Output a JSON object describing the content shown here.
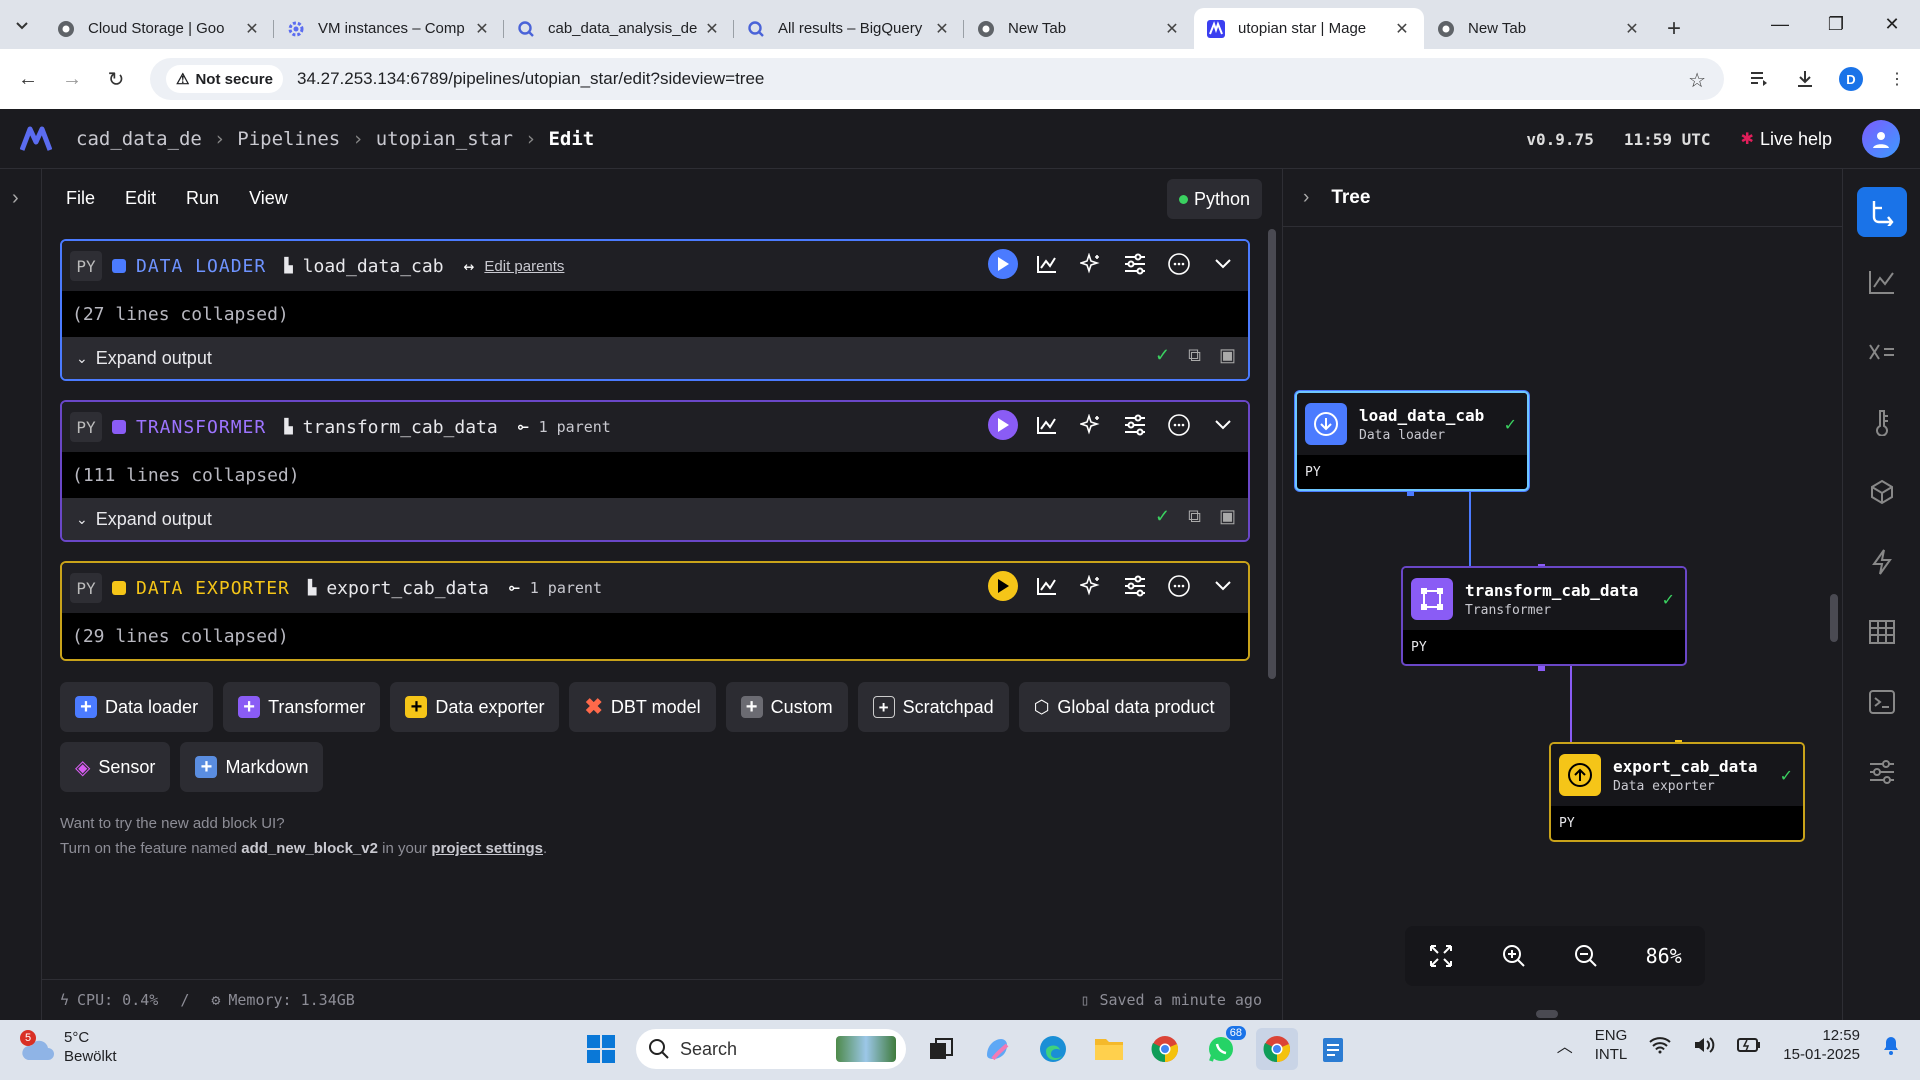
{
  "browser": {
    "tabs": [
      {
        "title": "Cloud Storage | Goo",
        "icon": "chrome-icon"
      },
      {
        "title": "VM instances – Comp",
        "icon": "gear-icon"
      },
      {
        "title": "cab_data_analysis_de",
        "icon": "bigquery-icon"
      },
      {
        "title": "All results – BigQuery",
        "icon": "bigquery-icon"
      },
      {
        "title": "New Tab",
        "icon": "chrome-icon"
      },
      {
        "title": "utopian star | Mage",
        "icon": "mage-icon",
        "active": true
      },
      {
        "title": "New Tab",
        "icon": "chrome-icon"
      }
    ],
    "security_label": "Not secure",
    "url": "34.27.253.134:6789/pipelines/utopian_star/edit?sideview=tree",
    "profile_initial": "D"
  },
  "app": {
    "breadcrumbs": [
      "cad_data_de",
      "Pipelines",
      "utopian_star",
      "Edit"
    ],
    "version": "v0.9.75",
    "time": "11:59 UTC",
    "live_help": "Live help",
    "menu": [
      "File",
      "Edit",
      "Run",
      "View"
    ],
    "language": "Python",
    "blocks": [
      {
        "py": "PY",
        "type": "DATA LOADER",
        "name": "load_data_cab",
        "parent_text": "Edit parents",
        "collapsed": "(27 lines collapsed)",
        "output": "Expand output",
        "color": "#4b7bff"
      },
      {
        "py": "PY",
        "type": "TRANSFORMER",
        "name": "transform_cab_data",
        "parent_text": "1 parent",
        "collapsed": "(111 lines collapsed)",
        "output": "Expand output",
        "color": "#8a5cf5"
      },
      {
        "py": "PY",
        "type": "DATA EXPORTER",
        "name": "export_cab_data",
        "parent_text": "1 parent",
        "collapsed": "(29 lines collapsed)",
        "color": "#f5c518"
      }
    ],
    "add_buttons": [
      "Data loader",
      "Transformer",
      "Data exporter",
      "DBT model",
      "Custom",
      "Scratchpad",
      "Global data product",
      "Sensor",
      "Markdown"
    ],
    "note": {
      "line1": "Want to try the new add block UI?",
      "line2_pre": "Turn on the feature named ",
      "feature": "add_new_block_v2",
      "line2_mid": " in your ",
      "link": "project settings",
      "line2_end": "."
    },
    "status": {
      "cpu": "CPU: 0.4%",
      "slash": "/",
      "memory": "Memory: 1.34GB",
      "saved": "Saved a minute ago"
    },
    "tree": {
      "title": "Tree",
      "nodes": [
        {
          "name": "load_data_cab",
          "type": "Data loader",
          "lang": "PY"
        },
        {
          "name": "transform_cab_data",
          "type": "Transformer",
          "lang": "PY"
        },
        {
          "name": "export_cab_data",
          "type": "Data exporter",
          "lang": "PY"
        }
      ],
      "zoom": "86%"
    }
  },
  "taskbar": {
    "weather_badge": "5",
    "temp": "5°C",
    "weather": "Bewölkt",
    "search": "Search",
    "whatsapp_badge": "68",
    "lang1": "ENG",
    "lang2": "INTL",
    "time": "12:59",
    "date": "15-01-2025"
  }
}
